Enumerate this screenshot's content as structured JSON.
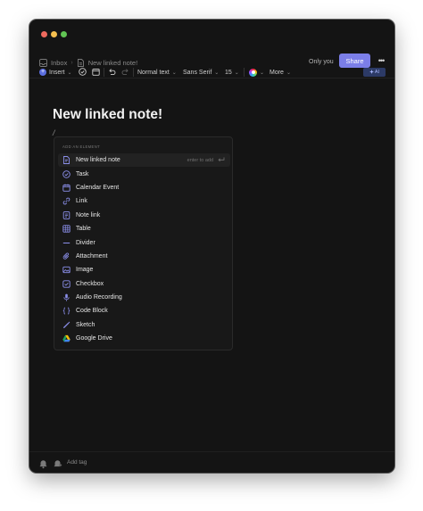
{
  "breadcrumb": {
    "inbox": "Inbox",
    "separator": "›",
    "note": "New linked note!"
  },
  "header": {
    "visibility": "Only you",
    "share_label": "Share",
    "more_label": "•••"
  },
  "toolbar": {
    "insert_label": "Insert",
    "insert_icon": "+",
    "text_style": "Normal text",
    "font": "Sans Serif",
    "font_size": "15",
    "more_label": "More",
    "ai_label": "AI",
    "chevron": "⌄"
  },
  "note": {
    "title": "New linked note!",
    "caret": "/"
  },
  "popup": {
    "header": "ADD AN ELEMENT",
    "hint_text": "enter to add",
    "items": [
      {
        "label": "New linked note",
        "icon": "linked-note-icon",
        "active": true
      },
      {
        "label": "Task",
        "icon": "task-icon"
      },
      {
        "label": "Calendar Event",
        "icon": "calendar-icon"
      },
      {
        "label": "Link",
        "icon": "link-icon"
      },
      {
        "label": "Note link",
        "icon": "note-link-icon"
      },
      {
        "label": "Table",
        "icon": "table-icon"
      },
      {
        "label": "Divider",
        "icon": "divider-icon"
      },
      {
        "label": "Attachment",
        "icon": "attachment-icon"
      },
      {
        "label": "Image",
        "icon": "image-icon"
      },
      {
        "label": "Checkbox",
        "icon": "checkbox-icon"
      },
      {
        "label": "Audio Recording",
        "icon": "microphone-icon"
      },
      {
        "label": "Code Block",
        "icon": "code-icon"
      },
      {
        "label": "Sketch",
        "icon": "sketch-icon"
      },
      {
        "label": "Google Drive",
        "icon": "google-drive-icon"
      }
    ]
  },
  "footer": {
    "add_tag": "Add tag"
  },
  "colors": {
    "accent": "#7b7ee8",
    "background": "#141414",
    "icon": "#8b8fea"
  }
}
